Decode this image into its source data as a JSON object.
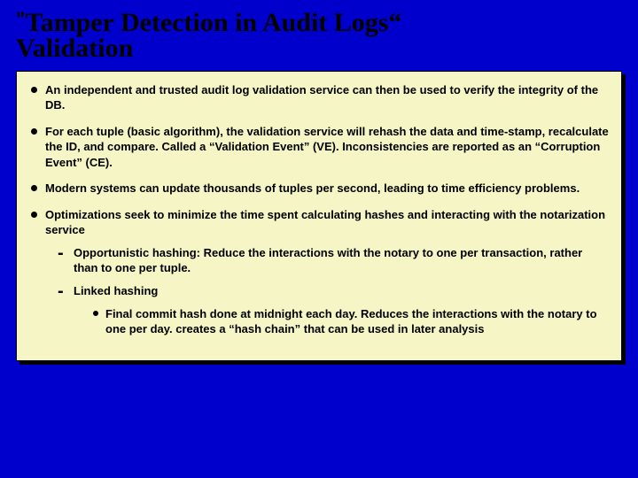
{
  "title": {
    "line1_prefix_quote": "\"",
    "line1_text": "Tamper Detection in Audit Logs“",
    "line2_text": "Validation"
  },
  "bullets": {
    "b1_pre": "An ",
    "b1_bold": "independent and trusted audit log validation service",
    "b1_post": " can then be used to verify the integrity of the DB.",
    "b2": "For each tuple (basic algorithm), the validation service will rehash the data and time-stamp, recalculate the ID, and compare.  Called a “Validation Event” (VE). Inconsistencies are reported as an “Corruption Event” (CE).",
    "b3": "Modern systems can update thousands of tuples per second, leading to time efficiency problems.",
    "b4": "Optimizations seek to minimize the time spent calculating hashes and interacting with the notarization service",
    "sub1": "Opportunistic hashing: Reduce the interactions with the notary to one per transaction, rather than to one per tuple.",
    "sub2": "Linked hashing",
    "subsub1": "Final commit hash done at midnight each day. Reduces the interactions with the notary to one per day.  creates a “hash chain” that can be used in later analysis"
  }
}
